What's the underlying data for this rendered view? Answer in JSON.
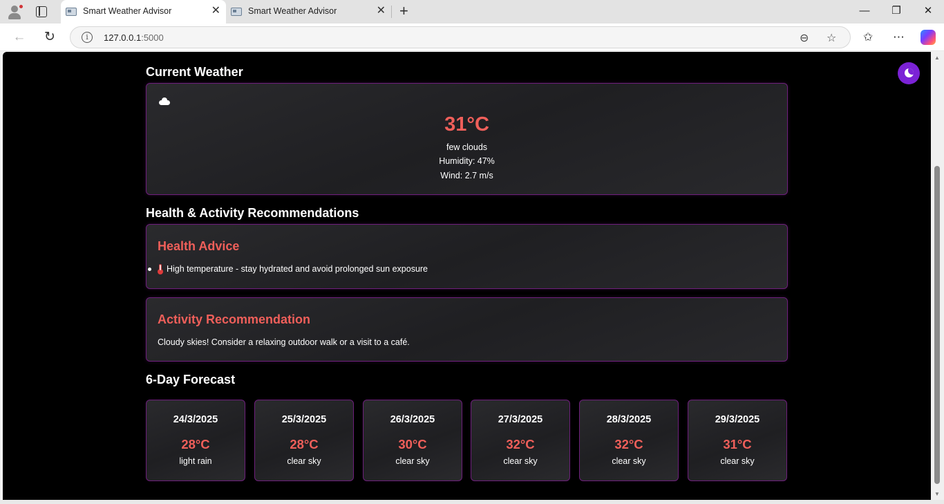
{
  "browser": {
    "tabs": [
      {
        "title": "Smart Weather Advisor",
        "active": true
      },
      {
        "title": "Smart Weather Advisor",
        "active": false
      }
    ],
    "address": {
      "host": "127.0.0.1",
      "port": ":5000"
    },
    "icons": [
      "profile-icon",
      "tab-actions-icon",
      "back-icon",
      "refresh-icon",
      "info-icon",
      "zoom-out-icon",
      "favorite-star-icon",
      "favorites-icon",
      "more-icon",
      "copilot-icon",
      "minimize-icon",
      "restore-icon",
      "close-icon"
    ]
  },
  "current": {
    "section_title": "Current Weather",
    "icon": "cloud-icon",
    "temperature": "31°C",
    "description": "few clouds",
    "humidity": "Humidity: 47%",
    "wind": "Wind: 2.7 m/s"
  },
  "recommendations": {
    "section_title": "Health & Activity Recommendations",
    "health": {
      "title": "Health Advice",
      "items": [
        {
          "icon": "thermometer-icon",
          "text": "High temperature - stay hydrated and avoid prolonged sun exposure"
        }
      ]
    },
    "activity": {
      "title": "Activity Recommendation",
      "text": "Cloudy skies! Consider a relaxing outdoor walk or a visit to a café."
    }
  },
  "forecast": {
    "section_title": "6-Day Forecast",
    "days": [
      {
        "date": "24/3/2025",
        "temp": "28°C",
        "desc": "light rain"
      },
      {
        "date": "25/3/2025",
        "temp": "28°C",
        "desc": "clear sky"
      },
      {
        "date": "26/3/2025",
        "temp": "30°C",
        "desc": "clear sky"
      },
      {
        "date": "27/3/2025",
        "temp": "32°C",
        "desc": "clear sky"
      },
      {
        "date": "28/3/2025",
        "temp": "32°C",
        "desc": "clear sky"
      },
      {
        "date": "29/3/2025",
        "temp": "31°C",
        "desc": "clear sky"
      }
    ]
  },
  "theme_toggle": {
    "icon": "moon-icon",
    "color": "#7b22d6"
  },
  "colors": {
    "accent": "#ef5f5a",
    "border": "#6e1f7c",
    "background": "#000000"
  }
}
